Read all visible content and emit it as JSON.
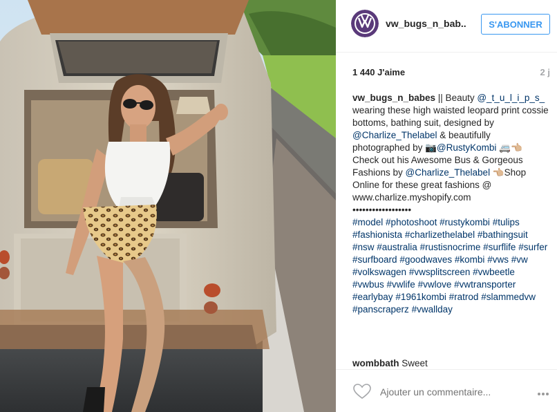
{
  "post": {
    "photo_icon": "photo-placeholder-van-woman"
  },
  "header": {
    "username": "vw_bugs_n_bab..",
    "follow_label": "S'ABONNER",
    "avatar_icon": "vw-logo-icon"
  },
  "stats": {
    "likes": "1 440 J'aime",
    "time": "2 j"
  },
  "caption": {
    "username": "vw_bugs_n_babes",
    "t1": " || Beauty ",
    "m1": "@_t_u_l_i_p_s_",
    "t2": " wearing these high waisted leopard print cossie bottoms, bathing suit, designed by ",
    "m2": "@Charlize_Thelabel",
    "t3": " & beautifully photographed by 📷",
    "m3": "@RustyKombi",
    "t4": " 🚐👈🏼 Check out his Awesome Bus & Gorgeous Fashions by ",
    "m4": "@Charlize_Thelabel",
    "t5": " 👈🏼Shop Online for these great fashions @ www.charlize.myshopify.com",
    "dots": "••••••••••••••••••",
    "hashtags": [
      "#model",
      "#photoshoot",
      "#rustykombi",
      "#tulips",
      "#fashionista",
      "#charlizethelabel",
      "#bathingsuit",
      "#nsw",
      "#australia",
      "#rustisnocrime",
      "#surflife",
      "#surfer",
      "#surfboard",
      "#goodwaves",
      "#kombi",
      "#vws",
      "#vw",
      "#volkswagen",
      "#vwsplitscreen",
      "#vwbeetle",
      "#vwbus",
      "#vwlife",
      "#vwlove",
      "#vwtransporter",
      "#earlybay",
      "#1961kombi",
      "#ratrod",
      "#slammedvw",
      "#panscraperz",
      "#vwallday"
    ]
  },
  "comments": [
    {
      "username": "wombbath",
      "text": " Sweet"
    }
  ],
  "footer": {
    "comment_placeholder": "Ajouter un commentaire...",
    "like_icon": "heart-outline-icon",
    "more_icon": "more-options-icon"
  }
}
